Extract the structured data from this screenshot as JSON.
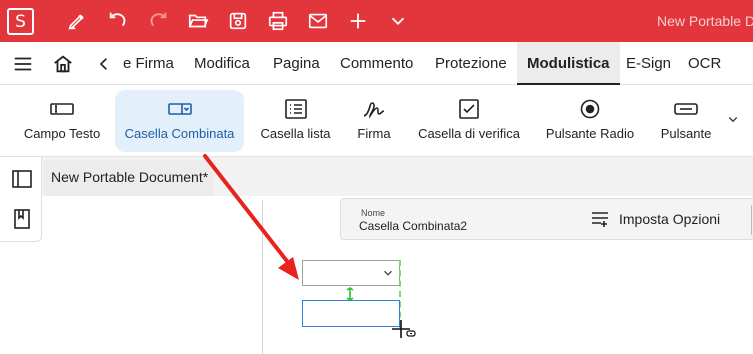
{
  "titlebar": {
    "app_logo_letter": "S",
    "document_title": "New Portable D",
    "quick_access": [
      "pen-icon",
      "undo-icon",
      "redo-icon",
      "open-folder-icon",
      "save-icon",
      "print-icon",
      "mail-icon",
      "add-icon",
      "chevron-down-icon"
    ]
  },
  "menubar": {
    "tabs": [
      {
        "label": "e Firma"
      },
      {
        "label": "Modifica"
      },
      {
        "label": "Pagina"
      },
      {
        "label": "Commento"
      },
      {
        "label": "Protezione"
      },
      {
        "label": "Modulistica"
      },
      {
        "label": "E-Sign"
      },
      {
        "label": "OCR"
      }
    ],
    "active_tab": "Modulistica"
  },
  "ribbon": {
    "tools": [
      {
        "label": "Campo Testo",
        "icon": "text-field-icon"
      },
      {
        "label": "Casella Combinata",
        "icon": "combo-box-icon",
        "active": true
      },
      {
        "label": "Casella lista",
        "icon": "list-box-icon"
      },
      {
        "label": "Firma",
        "icon": "signature-icon"
      },
      {
        "label": "Casella di verifica",
        "icon": "checkbox-icon"
      },
      {
        "label": "Pulsante Radio",
        "icon": "radio-button-icon"
      },
      {
        "label": "Pulsante",
        "icon": "button-icon"
      }
    ]
  },
  "document": {
    "tab_label": "New Portable Document*"
  },
  "properties": {
    "name_label": "Nome",
    "name_value": "Casella Combinata2",
    "options_label": "Imposta Opzioni"
  },
  "colors": {
    "accent": "#e3363c",
    "selected_tool_bg": "#e3f0fb",
    "annotation_arrow": "#e8231e",
    "new_field_border": "#2f80d8",
    "guide_green": "#3ecf3e"
  }
}
